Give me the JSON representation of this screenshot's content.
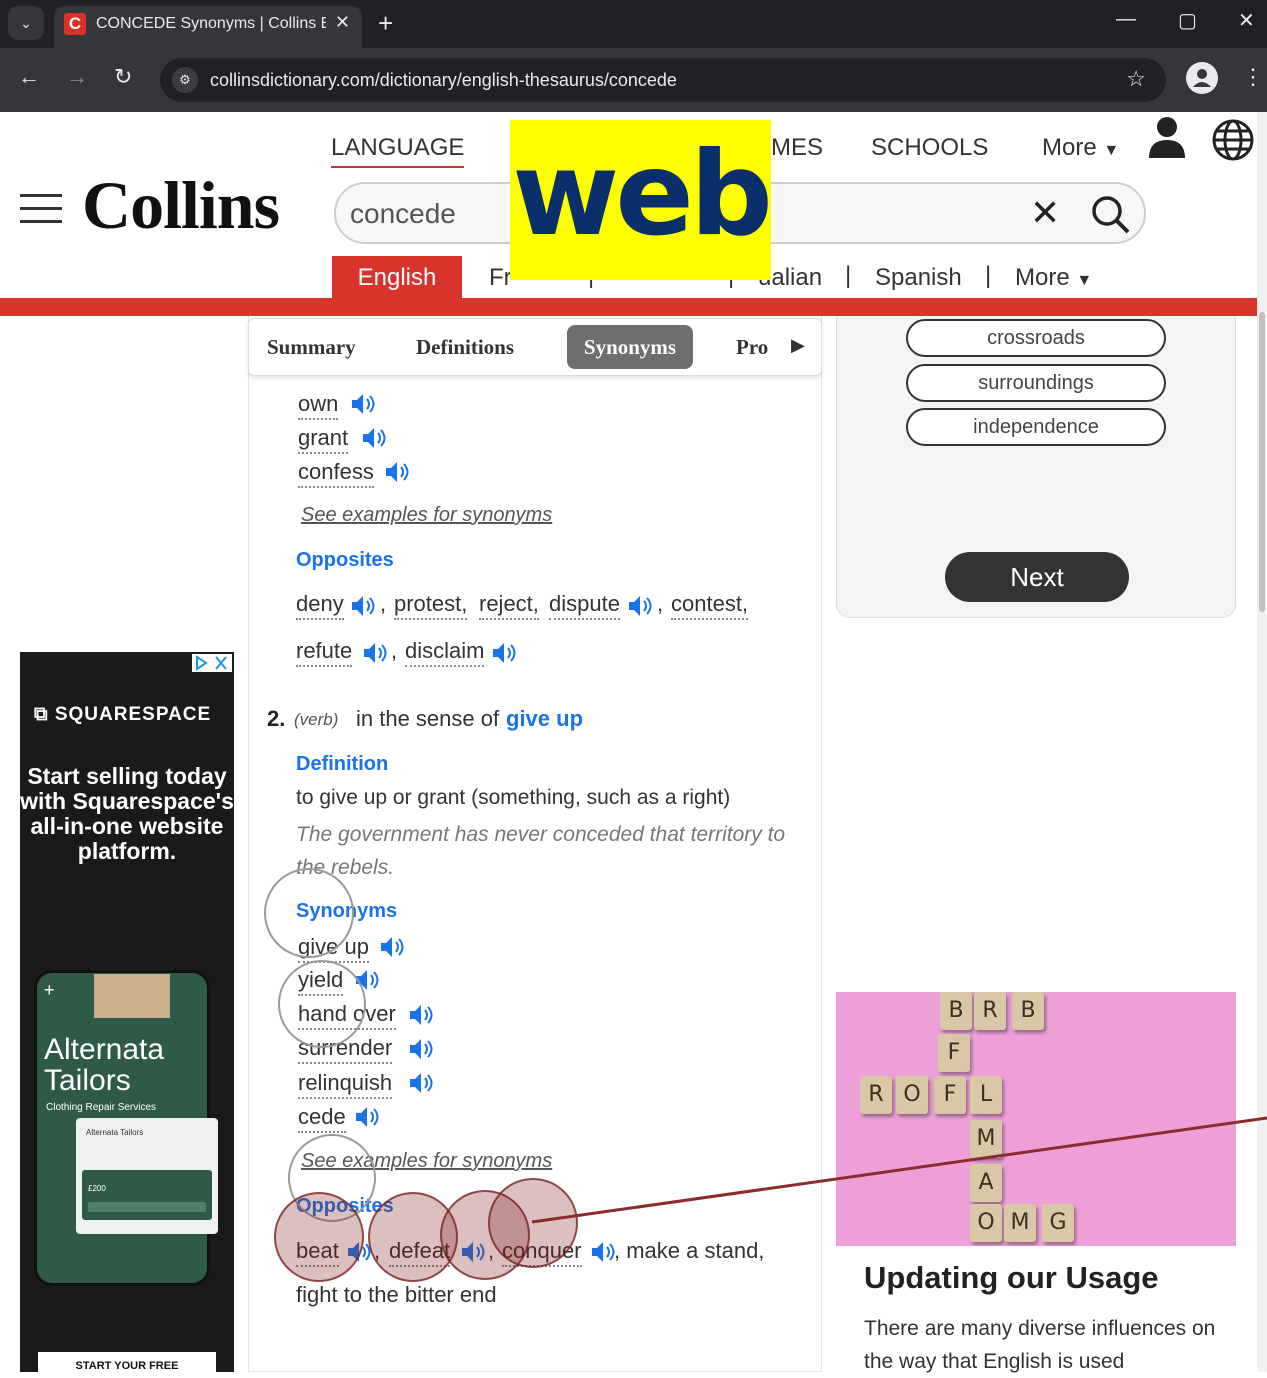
{
  "browser": {
    "tab_title": "CONCEDE Synonyms | Collins E",
    "tab_favicon": "C",
    "url": "collinsdictionary.com/dictionary/english-thesaurus/concede"
  },
  "header": {
    "nav": [
      "LANGUAGE",
      "MES",
      "SCHOOLS",
      "More"
    ],
    "logo": "Collins",
    "search_value": "concede",
    "watermark": "web",
    "languages": [
      "English",
      "Fr",
      "ualian",
      "Spanish",
      "More"
    ]
  },
  "subtabs": [
    "Summary",
    "Definitions",
    "Synonyms",
    "Pro"
  ],
  "sense1": {
    "synonyms": [
      "own",
      "grant",
      "confess"
    ],
    "examples_link": "See examples for synonyms",
    "opposites_label": "Opposites",
    "opposites_row1": [
      "deny",
      "protest,",
      "reject,",
      "dispute",
      "contest,"
    ],
    "opposites_row2": [
      "refute",
      "disclaim"
    ]
  },
  "sense2": {
    "number": "2.",
    "pos": "(verb)",
    "in_sense": "in the sense of",
    "sense_word": "give up",
    "definition_label": "Definition",
    "definition": "to give up or grant (something, such as a right)",
    "example": "The government has never conceded that territory to the rebels.",
    "synonyms_label": "Synonyms",
    "synonyms": [
      "give up",
      "yield",
      "hand over",
      "surrender",
      "relinquish",
      "cede"
    ],
    "examples_link": "See examples for synonyms",
    "opposites_label": "Opposites",
    "opposites": [
      "beat",
      "defeat",
      "conquer"
    ],
    "opposites_tail": ", make a stand,",
    "opposites_row2": "fight to the bitter end"
  },
  "quiz": {
    "options": [
      "crossroads",
      "surroundings",
      "independence"
    ],
    "next_label": "Next"
  },
  "usage": {
    "tiles": [
      "B",
      "R",
      "B",
      "F",
      "R",
      "O",
      "F",
      "L",
      "M",
      "A",
      "O",
      "M",
      "G"
    ],
    "title": "Updating our Usage",
    "text": "There are many diverse influences on the way that English is used"
  },
  "ad": {
    "brand": "SQUARESPACE",
    "headline": "Start selling today with Squarespace's all-in-one website platform.",
    "phone_title": "Alternata Tailors",
    "phone_sub": "Clothing Repair Services",
    "card_title": "Alternata Tailors",
    "card_price": "£200",
    "cta": "START YOUR FREE"
  }
}
